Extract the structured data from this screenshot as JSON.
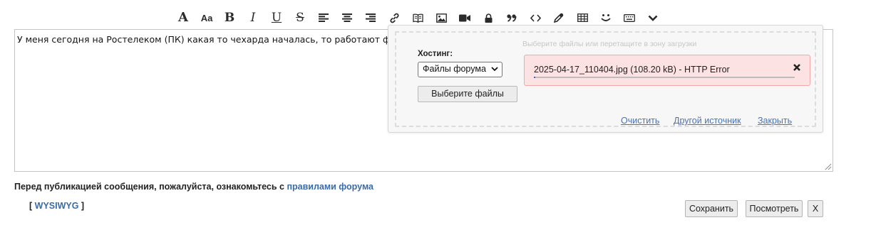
{
  "toolbar": {
    "items": [
      {
        "name": "font-family-button",
        "label": "A"
      },
      {
        "name": "font-size-button",
        "label": "Aa"
      },
      {
        "name": "bold-button",
        "label": "B"
      },
      {
        "name": "italic-button",
        "label": "I"
      },
      {
        "name": "underline-button",
        "label": "U"
      },
      {
        "name": "strikethrough-button",
        "label": "S"
      },
      {
        "name": "align-left-icon"
      },
      {
        "name": "align-center-icon"
      },
      {
        "name": "align-right-icon"
      },
      {
        "name": "link-icon"
      },
      {
        "name": "book-icon"
      },
      {
        "name": "image-icon"
      },
      {
        "name": "video-icon"
      },
      {
        "name": "lock-icon"
      },
      {
        "name": "quote-icon"
      },
      {
        "name": "code-icon"
      },
      {
        "name": "color-picker-icon"
      },
      {
        "name": "table-icon"
      },
      {
        "name": "smiley-icon"
      },
      {
        "name": "keyboard-icon"
      },
      {
        "name": "more-chevron-icon"
      }
    ]
  },
  "editor": {
    "text": "У меня сегодня на Ростелеком (ПК) какая то чехарда началась, то работают форумы т"
  },
  "upload": {
    "drop_hint": "Выберите файлы или перетащите в зону загрузки",
    "hosting_label": "Хостинг:",
    "hosting_selected": "Файлы форума",
    "choose_files_label": "Выберите файлы",
    "file": {
      "name": "2025-04-17_110404.jpg (108.20 kB) - HTTP Error",
      "progress": 0.005
    },
    "links": {
      "clear": "Очистить",
      "other_source": "Другой источник",
      "close": "Закрыть"
    },
    "colors": {
      "error_bg": "#fce2e2",
      "error_border": "#f0a8a8",
      "link": "#4a73b1"
    }
  },
  "footer": {
    "notice_prefix": "Перед публикацией сообщения, пожалуйста, ознакомьтесь с ",
    "notice_link": "правилами форума",
    "wysiwyg_open": "[ ",
    "wysiwyg_link": "WYSIWYG",
    "wysiwyg_close": " ]",
    "save_label": "Сохранить",
    "preview_label": "Посмотреть",
    "close_label": "X"
  }
}
